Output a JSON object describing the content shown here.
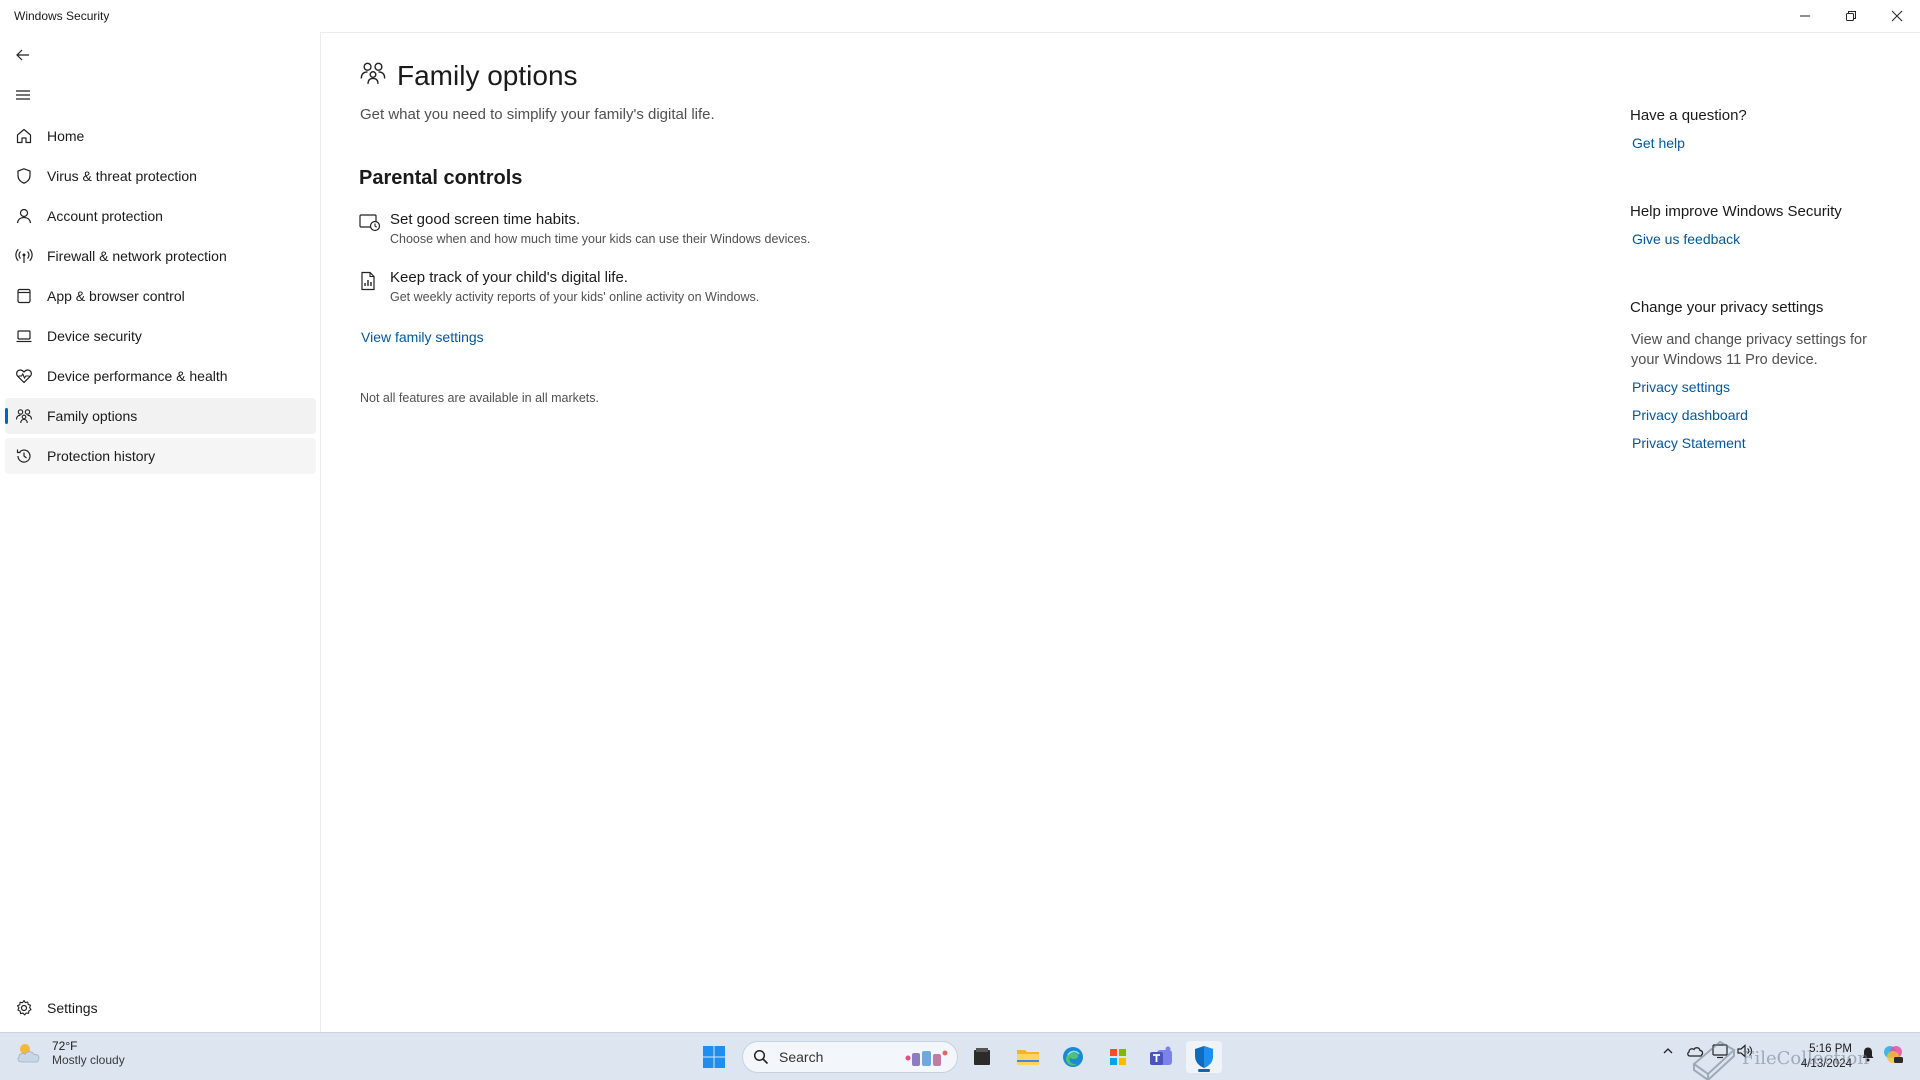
{
  "window": {
    "title": "Windows Security",
    "controls": {
      "minimize": "minimize",
      "maximize": "restore",
      "close": "close"
    }
  },
  "sidebar": {
    "back_icon": "back-arrow-icon",
    "menu_icon": "hamburger-menu-icon",
    "items": [
      {
        "label": "Home",
        "icon": "home-icon"
      },
      {
        "label": "Virus & threat protection",
        "icon": "shield-icon"
      },
      {
        "label": "Account protection",
        "icon": "person-icon"
      },
      {
        "label": "Firewall & network protection",
        "icon": "antenna-icon"
      },
      {
        "label": "App & browser control",
        "icon": "app-window-icon"
      },
      {
        "label": "Device security",
        "icon": "laptop-icon"
      },
      {
        "label": "Device performance & health",
        "icon": "heart-pulse-icon"
      },
      {
        "label": "Family options",
        "icon": "family-icon",
        "selected": true
      },
      {
        "label": "Protection history",
        "icon": "history-icon"
      }
    ],
    "settings_label": "Settings",
    "accent_color": "#0067c0"
  },
  "main": {
    "title": "Family options",
    "subtitle": "Get what you need to simplify your family's digital life.",
    "section_title": "Parental controls",
    "features": [
      {
        "title": "Set good screen time habits.",
        "description": "Choose when and how much time your kids can use their Windows devices.",
        "icon": "screen-time-icon"
      },
      {
        "title": "Keep track of your child's digital life.",
        "description": "Get weekly activity reports of your kids' online activity on Windows.",
        "icon": "activity-report-icon"
      }
    ],
    "view_link": "View family settings",
    "note": "Not all features are available in all markets."
  },
  "right_pane": {
    "question_title": "Have a question?",
    "get_help": "Get help",
    "improve_title": "Help improve Windows Security",
    "feedback": "Give us feedback",
    "privacy_title": "Change your privacy settings",
    "privacy_desc": "View and change privacy settings for your Windows 11 Pro device.",
    "privacy_settings": "Privacy settings",
    "privacy_dashboard": "Privacy dashboard",
    "privacy_statement": "Privacy Statement",
    "link_color": "#0058a3"
  },
  "taskbar": {
    "weather_temp": "72°F",
    "weather_condition": "Mostly cloudy",
    "search_label": "Search",
    "apps": [
      "start-icon",
      "file-manager-icon",
      "file-explorer-icon",
      "edge-icon",
      "store-icon",
      "teams-icon",
      "windows-security-icon"
    ],
    "time": "5:16 PM",
    "date": "4/13/2024",
    "watermark": "FileCollection"
  }
}
